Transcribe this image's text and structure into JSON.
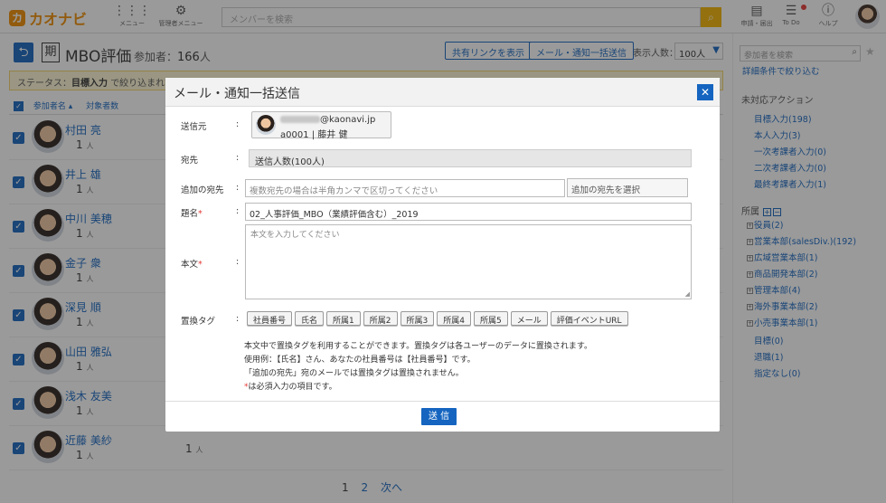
{
  "header": {
    "logo_text": "カオナビ",
    "logo_mark": "カ",
    "menu_label": "メニュー",
    "admin_label": "管理者メニュー",
    "search_placeholder": "メンバーを検索",
    "apply_label": "申請・届出",
    "todo_label": "To Do",
    "help_label": "ヘルプ"
  },
  "page": {
    "kiki_char": "期",
    "title": "MBO評価",
    "participants_label": "参加者：",
    "participants_count": "166",
    "participants_unit": "人",
    "share_link_button": "共有リンクを表示",
    "mail_button": "メール・通知一括送信",
    "display_count_label": "表示人数：",
    "display_count_value": "100人",
    "status_prefix": "ステータス：",
    "status_value": "目標入力",
    "status_suffix": "で絞り込まれて",
    "col_name": "参加者名",
    "col_targets": "対象者数",
    "rows": [
      {
        "name": "村田 亮",
        "count": "1",
        "unit": "人"
      },
      {
        "name": "井上 雄",
        "count": "1",
        "unit": "人"
      },
      {
        "name": "中川 美穂",
        "count": "1",
        "unit": "人"
      },
      {
        "name": "金子 衆",
        "count": "1",
        "unit": "人"
      },
      {
        "name": "深見 順",
        "count": "1",
        "unit": "人"
      },
      {
        "name": "山田 雅弘",
        "count": "1",
        "unit": "人"
      },
      {
        "name": "浅木 友美",
        "count": "1",
        "unit": "人"
      },
      {
        "name": "近藤 美紗",
        "count": "1",
        "unit": "人"
      }
    ],
    "extra_count": "1",
    "extra_unit": "人",
    "pager": {
      "p1": "1",
      "p2": "2",
      "next": "次へ"
    }
  },
  "right_panel": {
    "search_placeholder": "参加者を検索",
    "advanced_filter": "詳細条件で絞り込む",
    "pending_title": "未対応アクション",
    "pending": [
      "目標入力(198)",
      "本人入力(3)",
      "一次考課者入力(0)",
      "二次考課者入力(0)",
      "最終考課者入力(1)"
    ],
    "dept_title": "所属",
    "depts": [
      "役員(2)",
      "営業本部(salesDiv.)(192)",
      "広域営業本部(1)",
      "商品開発本部(2)",
      "管理本部(4)",
      "海外事業本部(2)",
      "小売事業本部(1)"
    ],
    "depts_flat": [
      "目標(0)",
      "退職(1)",
      "指定なし(0)"
    ]
  },
  "modal": {
    "title": "メール・通知一括送信",
    "from_label": "送信元",
    "from_email_domain": "@kaonavi.jp",
    "from_user": "a0001 | 藤井 健",
    "to_label": "宛先",
    "to_value": "送信人数(100人)",
    "extra_to_label": "追加の宛先",
    "extra_to_placeholder": "複数宛先の場合は半角カンマで区切ってください",
    "extra_to_select": "追加の宛先を選択",
    "subject_label": "題名",
    "subject_value": "02_人事評価_MBO（業績評価含む）_2019",
    "body_label": "本文",
    "body_placeholder": "本文を入力してください",
    "tags_label": "置換タグ",
    "tags": [
      "社員番号",
      "氏名",
      "所属1",
      "所属2",
      "所属3",
      "所属4",
      "所属5",
      "メール",
      "評価イベントURL"
    ],
    "note1": "本文中で置換タグを利用することができます。置換タグは各ユーザーのデータに置換されます。",
    "note2": "使用例：【氏名】さん、あなたの社員番号は【社員番号】です。",
    "note3": "「追加の宛先」宛のメールでは置換タグは置換されません。",
    "required_mark": "*",
    "note4": "は必須入力の項目です。",
    "send_button": "送 信",
    "colon": ":"
  },
  "colors": {
    "accent": "#1565c0",
    "brand": "#f08c00",
    "required": "#e53935"
  }
}
